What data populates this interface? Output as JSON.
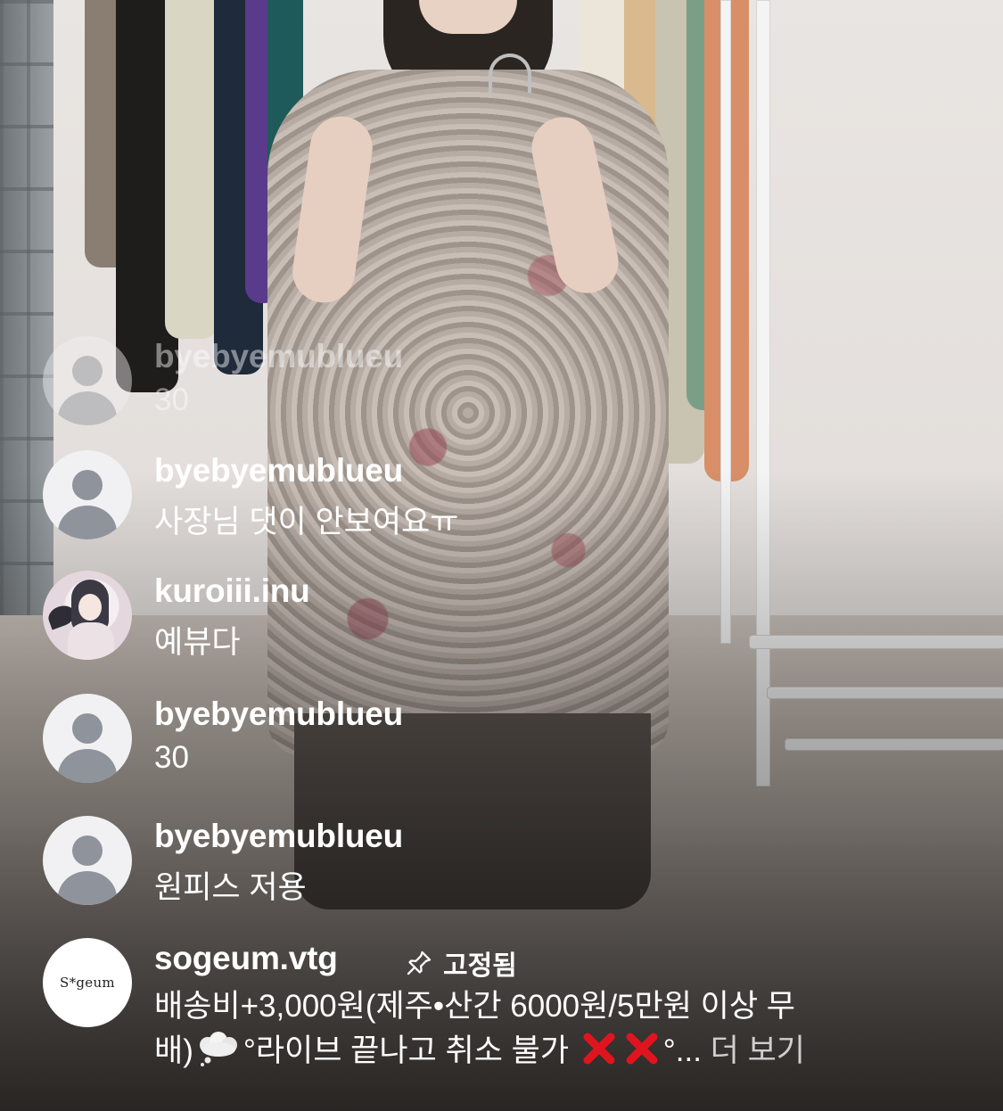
{
  "comments": [
    {
      "username": "byebyemublueu",
      "message": "30",
      "avatar": "default-avatar"
    },
    {
      "username": "byebyemublueu",
      "message": "사장님 댓이 안보여요ㅠ",
      "avatar": "default-avatar"
    },
    {
      "username": "kuroiii.inu",
      "message": "예뷰다",
      "avatar": "anime-avatar"
    },
    {
      "username": "byebyemublueu",
      "message": "30",
      "avatar": "default-avatar"
    },
    {
      "username": "byebyemublueu",
      "message": "원피스 저용",
      "avatar": "default-avatar"
    }
  ],
  "pinned_comment": {
    "username": "sogeum.vtg",
    "avatar_text": "S*geum",
    "pin_icon": "pin-icon",
    "pinned_label": "고정됨",
    "line1": "배송비+3,000원(제주•산간 6000원/5만원 이상 무",
    "line2_start": "배)",
    "line2_mid": "°라이브 끝나고 취소 불가",
    "line2_tail": "°...",
    "more_label": "더 보기"
  },
  "icons": {
    "cloud": "thought-cloud-icon",
    "cross": "red-cross-icon",
    "cross_color": "#e0141e"
  }
}
